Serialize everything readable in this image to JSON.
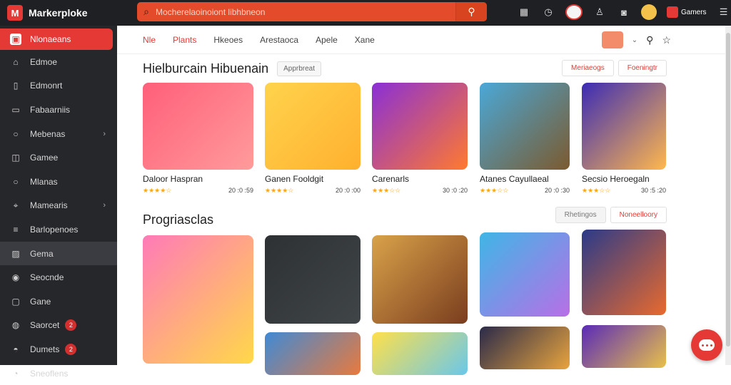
{
  "app": {
    "name": "Markerplokе"
  },
  "search": {
    "placeholder": "Mocherelaoinoiont libhbneon"
  },
  "topbar": {
    "user_label": "Gamers"
  },
  "sidebar": {
    "items": [
      {
        "label": "Nlonaeans",
        "icon": "store-icon",
        "state": "active"
      },
      {
        "label": "Edmoe",
        "icon": "home-icon"
      },
      {
        "label": "Edmonrt",
        "icon": "bookmark-icon"
      },
      {
        "label": "Fabaarniis",
        "icon": "monitor-icon"
      },
      {
        "label": "Mebenas",
        "icon": "circle-icon",
        "chevron": true
      },
      {
        "label": "Gamee",
        "icon": "gamepad-icon"
      },
      {
        "label": "Mlanas",
        "icon": "circle-icon"
      },
      {
        "label": "Mamearis",
        "icon": "tag-icon",
        "chevron": true
      },
      {
        "label": "Barlopenoes",
        "icon": "list-icon"
      },
      {
        "label": "Gema",
        "icon": "image-icon",
        "state": "hover"
      },
      {
        "label": "Seocnde",
        "icon": "disc-icon"
      },
      {
        "label": "Gane",
        "icon": "trash-icon"
      },
      {
        "label": "Saorcet",
        "icon": "globe-icon",
        "badge": "2"
      },
      {
        "label": "Dumets",
        "icon": "chat-icon",
        "badge": "2"
      },
      {
        "label": "Sneoflens",
        "icon": "user-icon"
      }
    ]
  },
  "tabs": [
    {
      "label": "Nle",
      "active": true
    },
    {
      "label": "Plants",
      "active": true
    },
    {
      "label": "Hkeoes"
    },
    {
      "label": "Arestaoca"
    },
    {
      "label": "Apele"
    },
    {
      "label": "Xane"
    }
  ],
  "sections": [
    {
      "title": "Hielburcain Hibuenain",
      "pill": "Apprbreat",
      "buttons": [
        "Meriaeogs",
        "Foeningtr"
      ],
      "cards": [
        {
          "title": "Daloor Haspran",
          "rating": "★★★★☆",
          "meta": "20 :0 :59",
          "colors": [
            "#ff5f7a",
            "#ff9b9b"
          ]
        },
        {
          "title": "Ganen Fooldgit",
          "rating": "★★★★☆",
          "meta": "20 :0 :00",
          "colors": [
            "#ffd34d",
            "#ffb02e"
          ]
        },
        {
          "title": "Carenarls",
          "rating": "★★★☆☆",
          "meta": "30 :0 :20",
          "colors": [
            "#8a2fd6",
            "#ff7a2f"
          ]
        },
        {
          "title": "Atanes Cayullaeal",
          "rating": "★★★☆☆",
          "meta": "20 :0 :30",
          "colors": [
            "#4aa8d8",
            "#7b5a2e"
          ]
        },
        {
          "title": "Secsio Heroegaln",
          "rating": "★★★☆☆",
          "meta": "30 :5 :20",
          "colors": [
            "#3b2bb5",
            "#ffb84d"
          ]
        }
      ]
    },
    {
      "title": "Progriasclas",
      "buttons": [
        "Rhetingos",
        "Noneelloory"
      ],
      "cards": [
        {
          "colors": [
            "#ff7ab8",
            "#ffd84a"
          ]
        },
        {
          "colors": [
            "#2d3133",
            "#404548"
          ]
        },
        {
          "colors": [
            "#d9a24a",
            "#7a3d1e"
          ]
        },
        {
          "colors": [
            "#3fb6e6",
            "#b86fe6"
          ]
        },
        {
          "colors": [
            "#2a3a8a",
            "#e86a2e"
          ]
        },
        {
          "colors": [
            "#3f8ad6",
            "#e87a3e"
          ]
        },
        {
          "colors": [
            "#ffe04a",
            "#6ac7ea"
          ]
        },
        {
          "colors": [
            "#2a2a4a",
            "#e8a43e"
          ]
        },
        {
          "colors": [
            "#5a2ab8",
            "#e8c04a"
          ]
        }
      ]
    }
  ],
  "accent": "#e53935"
}
